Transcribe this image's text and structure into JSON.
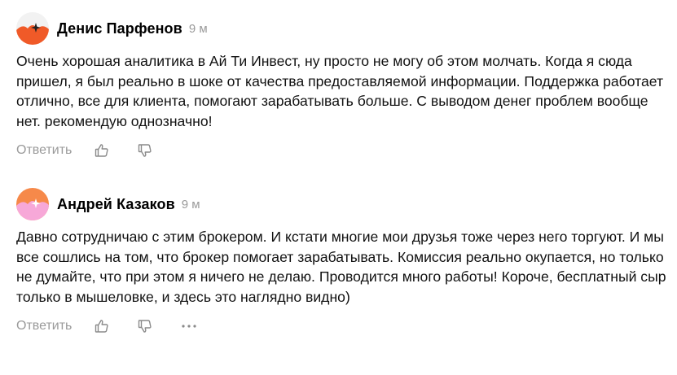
{
  "comments": [
    {
      "author": "Денис Парфенов",
      "time": "9 м",
      "avatar_icon": "sparkle-avatar-icon",
      "avatar_colors": [
        "#ffffff",
        "#f05a28"
      ],
      "text": "Очень хорошая аналитика в Ай Ти Инвест, ну просто не могу об этом молчать. Когда я сюда пришел, я был реально в шоке от качества предоставляемой информации. Поддержка работает отлично, все для клиента, помогают зарабатывать больше. С выводом денег проблем вообще нет. рекомендую однозначно!",
      "reply_label": "Ответить"
    },
    {
      "author": "Андрей Казаков",
      "time": "9 м",
      "avatar_icon": "sparkle-avatar-icon",
      "avatar_colors": [
        "#f6894a",
        "#f7a8d8"
      ],
      "text": "Давно сотрудничаю с этим брокером. И кстати многие мои друзья тоже через него торгуют. И мы все сошлись на том, что брокер помогает зарабатывать. Комиссия реально окупается, но только не думайте, что при этом я ничего не делаю. Проводится много работы! Короче, бесплатный сыр только в мышеловке, и здесь это наглядно видно)",
      "reply_label": "Ответить"
    }
  ]
}
